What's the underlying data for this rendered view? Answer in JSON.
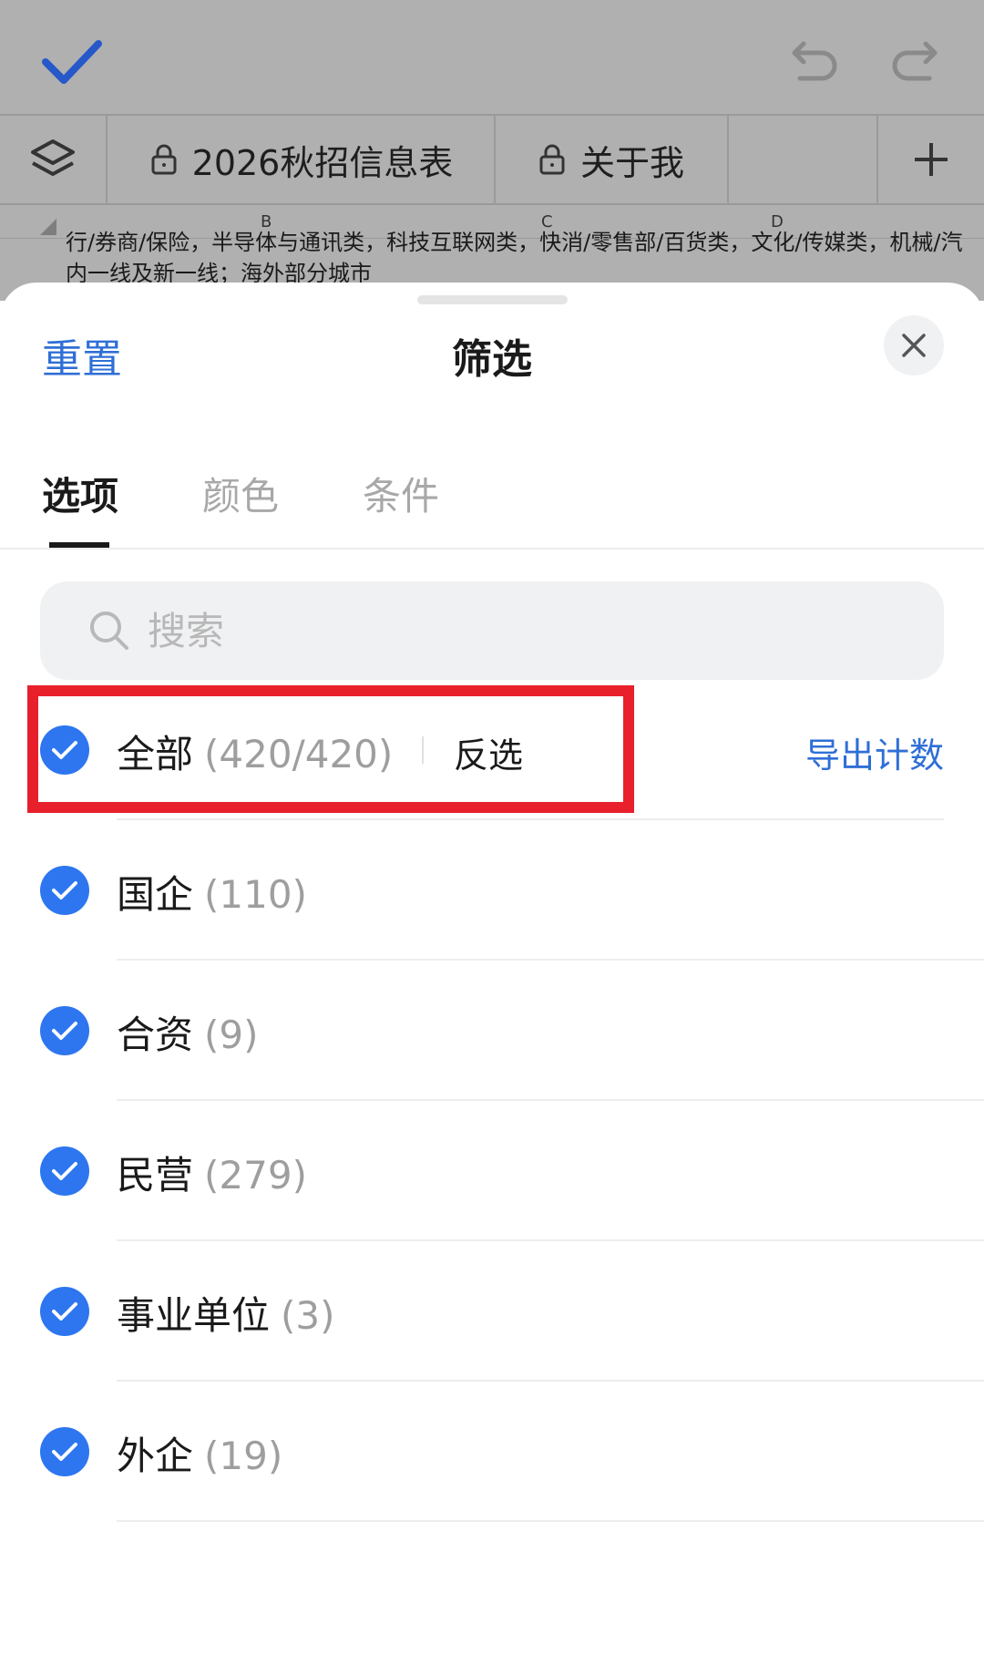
{
  "background": {
    "sheet_tabs": [
      {
        "label": "2026秋招信息表"
      },
      {
        "label": "关于我"
      }
    ],
    "columns": [
      "B",
      "C",
      "D"
    ],
    "cell_lines": [
      "行/券商/保险，半导体与通讯类，科技互联网类，快消/零售部/百货类，文化/传媒类，机械/汽",
      "内一线及新一线；海外部分城市"
    ]
  },
  "filter_sheet": {
    "reset_label": "重置",
    "title": "筛选",
    "tabs": [
      {
        "label": "选项",
        "active": true
      },
      {
        "label": "颜色",
        "active": false
      },
      {
        "label": "条件",
        "active": false
      }
    ],
    "search": {
      "placeholder": "搜索",
      "value": ""
    },
    "all_option": {
      "label": "全部",
      "count": "(420/420)",
      "checked": true,
      "invert_label": "反选",
      "export_label": "导出计数"
    },
    "options": [
      {
        "label": "国企",
        "count": "(110)",
        "checked": true
      },
      {
        "label": "合资",
        "count": "(9)",
        "checked": true
      },
      {
        "label": "民营",
        "count": "(279)",
        "checked": true
      },
      {
        "label": "事业单位",
        "count": "(3)",
        "checked": true
      },
      {
        "label": "外企",
        "count": "(19)",
        "checked": true
      }
    ]
  },
  "colors": {
    "accent": "#2d76f0",
    "link": "#2f6fd6",
    "highlight": "#e8202b",
    "dim_background": "#b0b0b0"
  }
}
